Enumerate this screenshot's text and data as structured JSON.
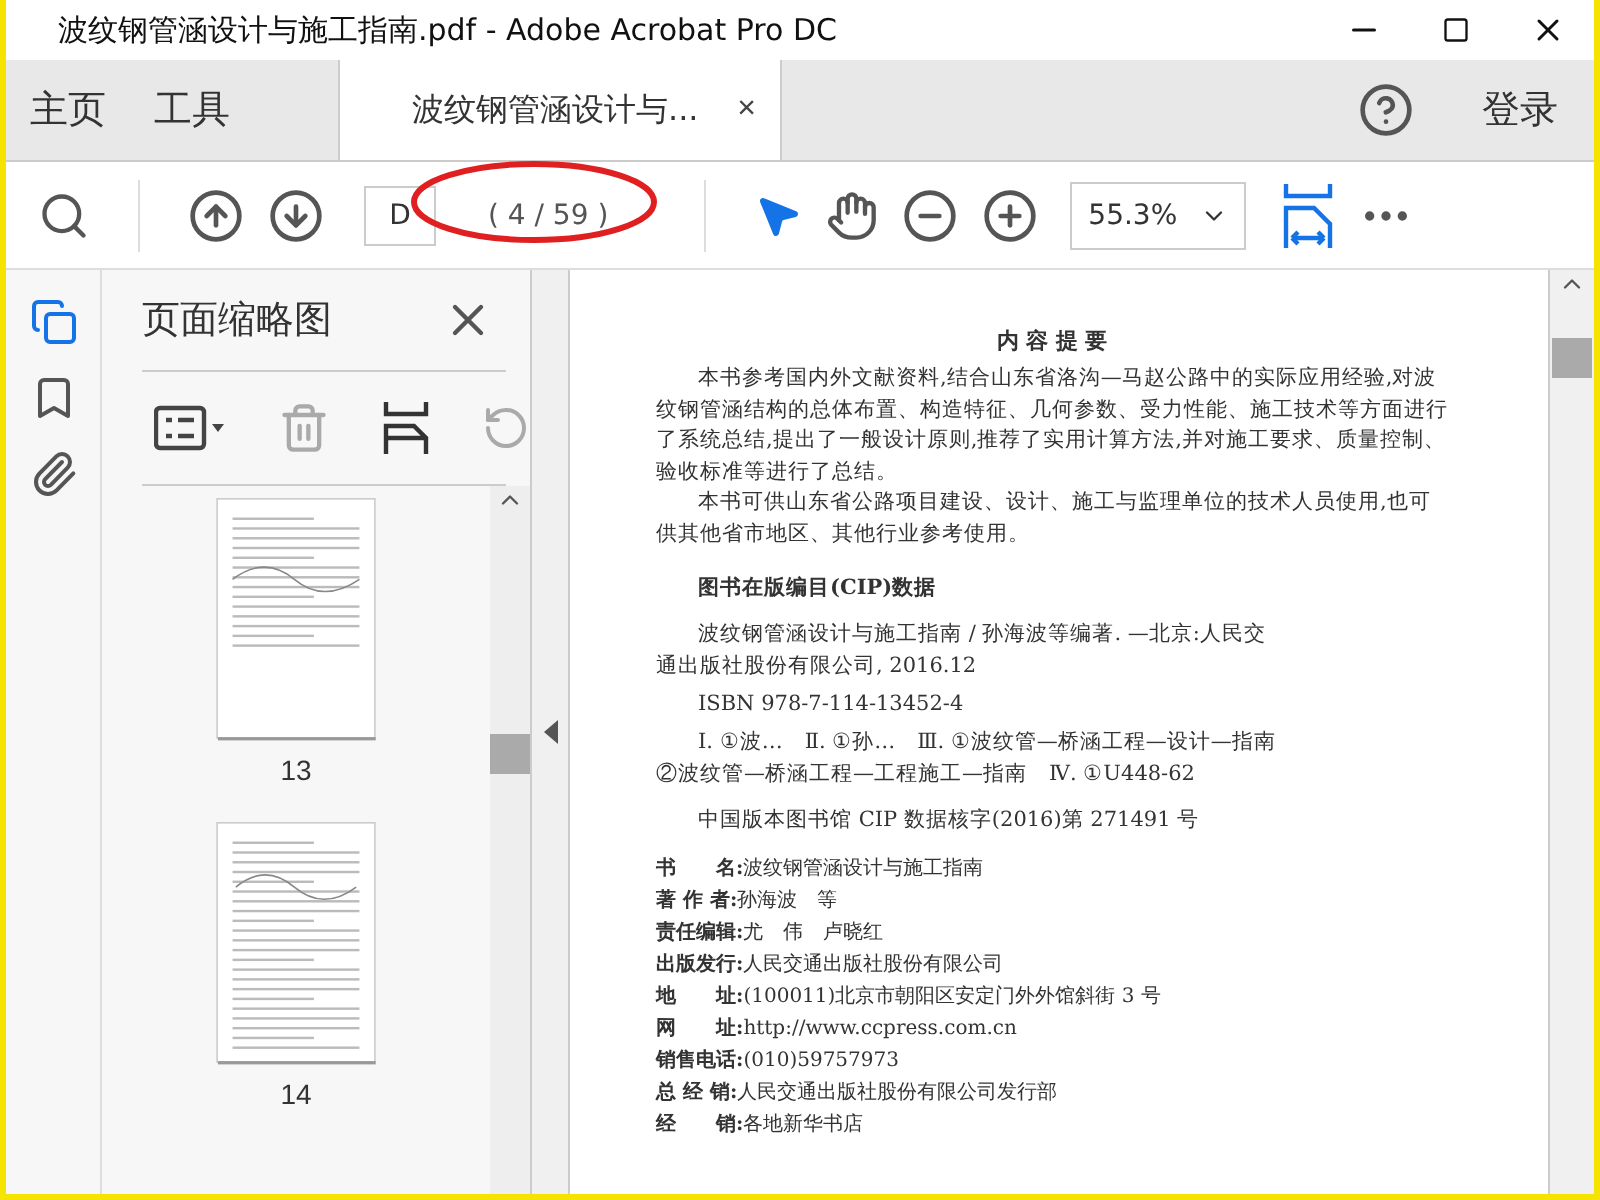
{
  "window": {
    "title": "波纹钢管涵设计与施工指南.pdf - Adobe Acrobat Pro DC"
  },
  "menu": [
    {
      "label": "主页",
      "selected": false
    },
    {
      "label": "工具",
      "selected": false
    }
  ],
  "document_tab": {
    "label": "波纹钢管涵设计与...",
    "close": "×",
    "selected": true
  },
  "sign_in": "登录",
  "toolbar": {
    "page_field": "D",
    "page_count": "( 4 / 59 )",
    "zoom": "55.3%",
    "tools": [
      {
        "kind": "select",
        "selected": true
      },
      {
        "kind": "hand",
        "selected": false
      }
    ]
  },
  "sidebar": {
    "rail": [
      {
        "kind": "pages",
        "selected": true
      },
      {
        "kind": "bookmarks",
        "selected": false
      },
      {
        "kind": "attachments",
        "selected": false
      }
    ],
    "panel_title": "页面缩略图",
    "thumbnails": [
      {
        "label": "13",
        "kind": "single"
      },
      {
        "label": "14",
        "kind": "double"
      }
    ]
  },
  "document": {
    "heading": "内 容 提 要",
    "paragraphs": [
      "本书参考国内外文献资料,结合山东省洛沟—马赵公路中的实际应用经验,对波纹钢管涵结构的总体布置、构造特征、几何参数、受力性能、施工技术等方面进行了系统总结,提出了一般设计原则,推荐了实用计算方法,并对施工要求、质量控制、验收标准等进行了总结。",
      "本书可供山东省公路项目建设、设计、施工与监理单位的技术人员使用,也可供其他省市地区、其他行业参考使用。"
    ],
    "cip_title": "图书在版编目(CIP)数据",
    "cip_entries": [
      "波纹钢管涵设计与施工指南 / 孙海波等编著. —北京:人民交通出版社股份有限公司, 2016.12",
      "ISBN 978-7-114-13452-4",
      "Ⅰ. ①波…　Ⅱ. ①孙…　Ⅲ. ①波纹管—桥涵工程—设计—指南②波纹管—桥涵工程—工程施工—指南　Ⅳ. ①U448-62"
    ],
    "cip_number": "中国版本图书馆 CIP 数据核字(2016)第 271491 号",
    "info": [
      {
        "label": "书　　名:",
        "value": "波纹钢管涵设计与施工指南"
      },
      {
        "label": "著 作 者:",
        "value": "孙海波　等"
      },
      {
        "label": "责任编辑:",
        "value": "尤　伟　卢晓红"
      },
      {
        "label": "出版发行:",
        "value": "人民交通出版社股份有限公司"
      },
      {
        "label": "地　　址:",
        "value": "(100011)北京市朝阳区安定门外外馆斜街 3 号"
      },
      {
        "label": "网　　址:",
        "value": "http://www.ccpress.com.cn"
      },
      {
        "label": "销售电话:",
        "value": "(010)59757973"
      },
      {
        "label": "总 经 销:",
        "value": "人民交通出版社股份有限公司发行部"
      },
      {
        "label": "经　　销:",
        "value": "各地新华书店"
      }
    ]
  }
}
